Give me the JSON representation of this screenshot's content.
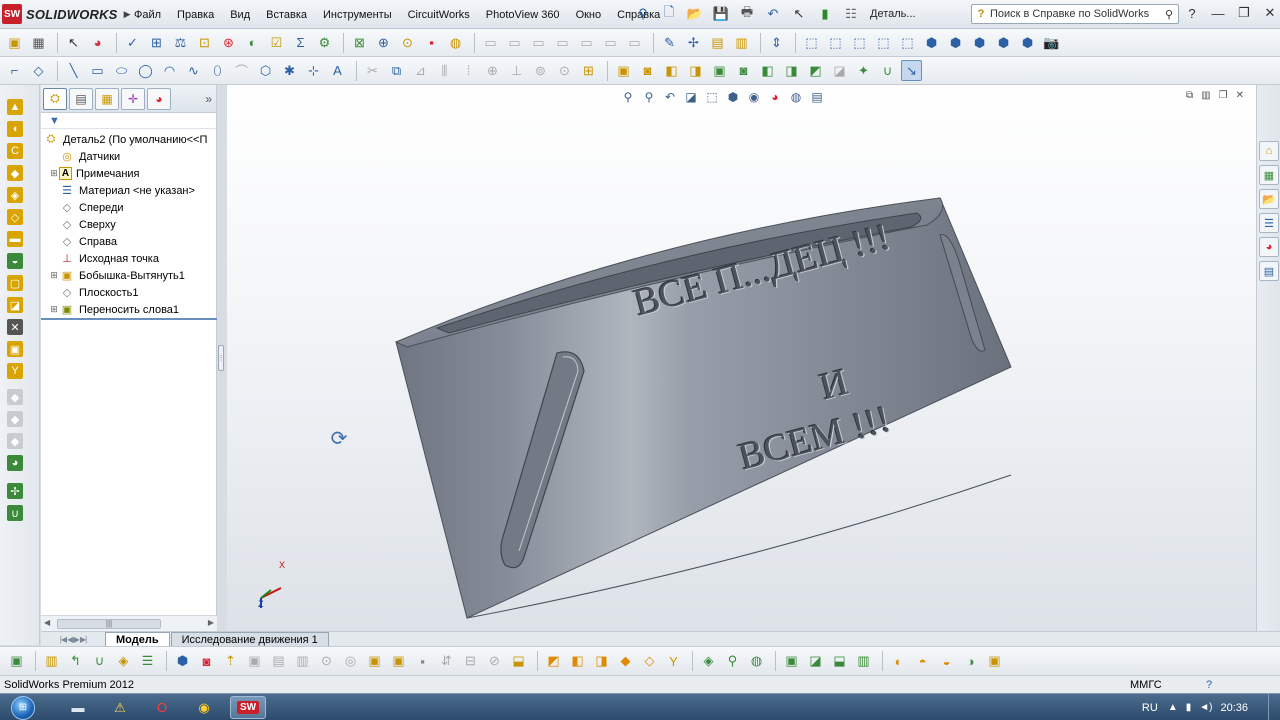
{
  "app": {
    "logo_text": "SOLIDWORKS",
    "menu": [
      "Файл",
      "Правка",
      "Вид",
      "Вставка",
      "Инструменты",
      "CircuitWorks",
      "PhotoView 360",
      "Окно",
      "Справка"
    ],
    "document_title": "Деталь...",
    "help_placeholder": "Поиск в Справке по SolidWorks"
  },
  "feature_tree": {
    "root": "Деталь2  (По умолчанию<<П",
    "items": [
      {
        "label": "Датчики",
        "icon": "sensors-icon",
        "expandable": false
      },
      {
        "label": "Примечания",
        "icon": "annotations-icon",
        "expandable": true
      },
      {
        "label": "Материал <не указан>",
        "icon": "material-icon",
        "expandable": false
      },
      {
        "label": "Спереди",
        "icon": "plane-icon",
        "expandable": false
      },
      {
        "label": "Сверху",
        "icon": "plane-icon",
        "expandable": false
      },
      {
        "label": "Справа",
        "icon": "plane-icon",
        "expandable": false
      },
      {
        "label": "Исходная точка",
        "icon": "origin-icon",
        "expandable": false
      },
      {
        "label": "Бобышка-Вытянуть1",
        "icon": "extrude-icon",
        "expandable": true
      },
      {
        "label": "Плоскость1",
        "icon": "plane-icon",
        "expandable": false
      },
      {
        "label": "Переносить слова1",
        "icon": "wrap-icon",
        "expandable": true
      }
    ]
  },
  "model": {
    "engraving_lines": [
      "ВСЕ П...ДЕЦ !!!",
      "И",
      "ВСЕМ !!!"
    ],
    "triad_x": "X",
    "triad_z": "Z"
  },
  "bottom_tabs": [
    "Модель",
    "Исследование движения 1"
  ],
  "status": {
    "product": "SolidWorks Premium 2012",
    "units": "ММГС",
    "help": "?"
  },
  "taskbar": {
    "lang": "RU",
    "clock": "20:36"
  },
  "colors": {
    "part_body": "#7e8592",
    "part_highlight": "#aeb4bd",
    "accent": "#2b5fa6",
    "logo_red": "#c8202a"
  }
}
